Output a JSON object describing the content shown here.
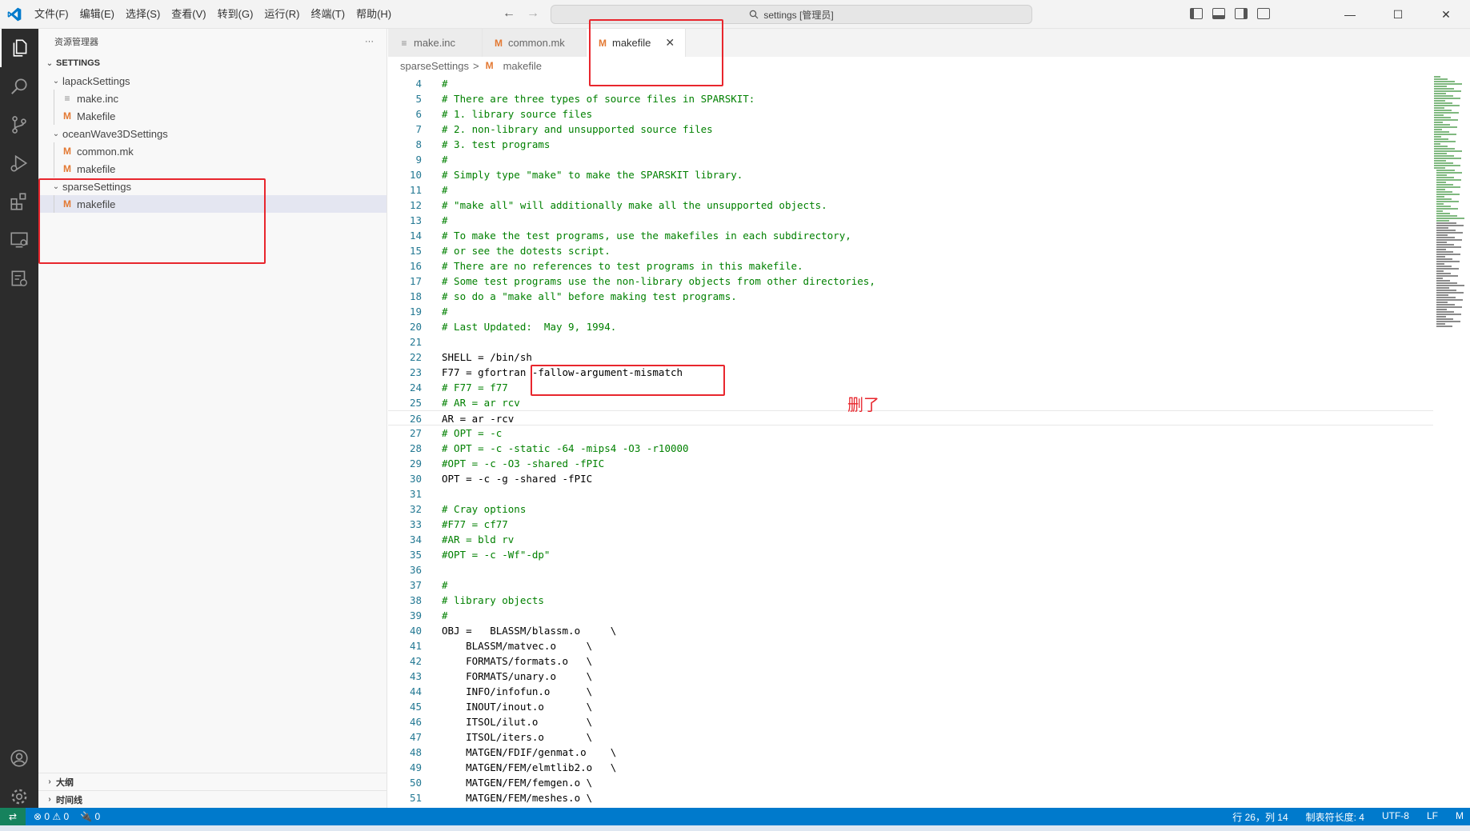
{
  "menubar": [
    "文件(F)",
    "编辑(E)",
    "选择(S)",
    "查看(V)",
    "转到(G)",
    "运行(R)",
    "终端(T)",
    "帮助(H)"
  ],
  "command_center": "settings [管理员]",
  "sidebar": {
    "title": "资源管理器",
    "more": "···",
    "section": "SETTINGS",
    "tree": [
      {
        "label": "lapackSettings",
        "type": "folder"
      },
      {
        "label": "make.inc",
        "type": "file"
      },
      {
        "label": "Makefile",
        "type": "m"
      },
      {
        "label": "oceanWave3DSettings",
        "type": "folder"
      },
      {
        "label": "common.mk",
        "type": "m"
      },
      {
        "label": "makefile",
        "type": "m"
      },
      {
        "label": "sparseSettings",
        "type": "folder"
      },
      {
        "label": "makefile",
        "type": "m"
      }
    ],
    "outline": "大纲",
    "timeline": "时间线"
  },
  "tabs": [
    {
      "label": "make.inc"
    },
    {
      "label": "common.mk"
    },
    {
      "label": "makefile"
    }
  ],
  "breadcrumb": {
    "folder": "sparseSettings",
    "file": "makefile",
    "sep": ">"
  },
  "code": [
    {
      "n": "4",
      "t": "#",
      "c": true
    },
    {
      "n": "5",
      "t": "# There are three types of source files in SPARSKIT:",
      "c": true
    },
    {
      "n": "6",
      "t": "# 1. library source files",
      "c": true
    },
    {
      "n": "7",
      "t": "# 2. non-library and unsupported source files",
      "c": true
    },
    {
      "n": "8",
      "t": "# 3. test programs",
      "c": true
    },
    {
      "n": "9",
      "t": "#",
      "c": true
    },
    {
      "n": "10",
      "t": "# Simply type \"make\" to make the SPARSKIT library.",
      "c": true
    },
    {
      "n": "11",
      "t": "#",
      "c": true
    },
    {
      "n": "12",
      "t": "# \"make all\" will additionally make all the unsupported objects.",
      "c": true
    },
    {
      "n": "13",
      "t": "#",
      "c": true
    },
    {
      "n": "14",
      "t": "# To make the test programs, use the makefiles in each subdirectory,",
      "c": true
    },
    {
      "n": "15",
      "t": "# or see the dotests script.",
      "c": true
    },
    {
      "n": "16",
      "t": "# There are no references to test programs in this makefile.",
      "c": true
    },
    {
      "n": "17",
      "t": "# Some test programs use the non-library objects from other directories,",
      "c": true
    },
    {
      "n": "18",
      "t": "# so do a \"make all\" before making test programs.",
      "c": true
    },
    {
      "n": "19",
      "t": "#",
      "c": true
    },
    {
      "n": "20",
      "t": "# Last Updated:  May 9, 1994.",
      "c": true
    },
    {
      "n": "21",
      "t": "",
      "c": false
    },
    {
      "n": "22",
      "t": "SHELL = /bin/sh",
      "c": false
    },
    {
      "n": "23",
      "t": "F77 = gfortran -fallow-argument-mismatch",
      "c": false
    },
    {
      "n": "24",
      "t": "# F77 = f77",
      "c": true
    },
    {
      "n": "25",
      "t": "# AR = ar rcv",
      "c": true
    },
    {
      "n": "26",
      "t": "AR = ar -rcv",
      "c": false
    },
    {
      "n": "27",
      "t": "# OPT = -c",
      "c": true
    },
    {
      "n": "28",
      "t": "# OPT = -c -static -64 -mips4 -O3 -r10000",
      "c": true
    },
    {
      "n": "29",
      "t": "#OPT = -c -O3 -shared -fPIC",
      "c": true
    },
    {
      "n": "30",
      "t": "OPT = -c -g -shared -fPIC",
      "c": false
    },
    {
      "n": "31",
      "t": "",
      "c": false
    },
    {
      "n": "32",
      "t": "# Cray options",
      "c": true
    },
    {
      "n": "33",
      "t": "#F77 = cf77",
      "c": true
    },
    {
      "n": "34",
      "t": "#AR = bld rv",
      "c": true
    },
    {
      "n": "35",
      "t": "#OPT = -c -Wf\"-dp\"",
      "c": true
    },
    {
      "n": "36",
      "t": "",
      "c": false
    },
    {
      "n": "37",
      "t": "#",
      "c": true
    },
    {
      "n": "38",
      "t": "# library objects",
      "c": true
    },
    {
      "n": "39",
      "t": "#",
      "c": true
    },
    {
      "n": "40",
      "t": "OBJ =   BLASSM/blassm.o     \\",
      "c": false
    },
    {
      "n": "41",
      "t": "    BLASSM/matvec.o     \\",
      "c": false
    },
    {
      "n": "42",
      "t": "    FORMATS/formats.o   \\",
      "c": false
    },
    {
      "n": "43",
      "t": "    FORMATS/unary.o     \\",
      "c": false
    },
    {
      "n": "44",
      "t": "    INFO/infofun.o      \\",
      "c": false
    },
    {
      "n": "45",
      "t": "    INOUT/inout.o       \\",
      "c": false
    },
    {
      "n": "46",
      "t": "    ITSOL/ilut.o        \\",
      "c": false
    },
    {
      "n": "47",
      "t": "    ITSOL/iters.o       \\",
      "c": false
    },
    {
      "n": "48",
      "t": "    MATGEN/FDIF/genmat.o    \\",
      "c": false
    },
    {
      "n": "49",
      "t": "    MATGEN/FEM/elmtlib2.o   \\",
      "c": false
    },
    {
      "n": "50",
      "t": "    MATGEN/FEM/femgen.o \\",
      "c": false
    },
    {
      "n": "51",
      "t": "    MATGEN/FEM/meshes.o \\",
      "c": false
    }
  ],
  "annotation": "删了",
  "statusbar": {
    "errors": "⊗ 0 ⚠ 0",
    "ports": "🔌 0",
    "position": "行 26，列 14",
    "tabsize": "制表符长度: 4",
    "encoding": "UTF-8",
    "eol": "LF",
    "lang": "M"
  },
  "colors": {
    "accent": "#007acc",
    "comment": "#008000",
    "line_number": "#237893",
    "annotation": "#e8262d"
  }
}
